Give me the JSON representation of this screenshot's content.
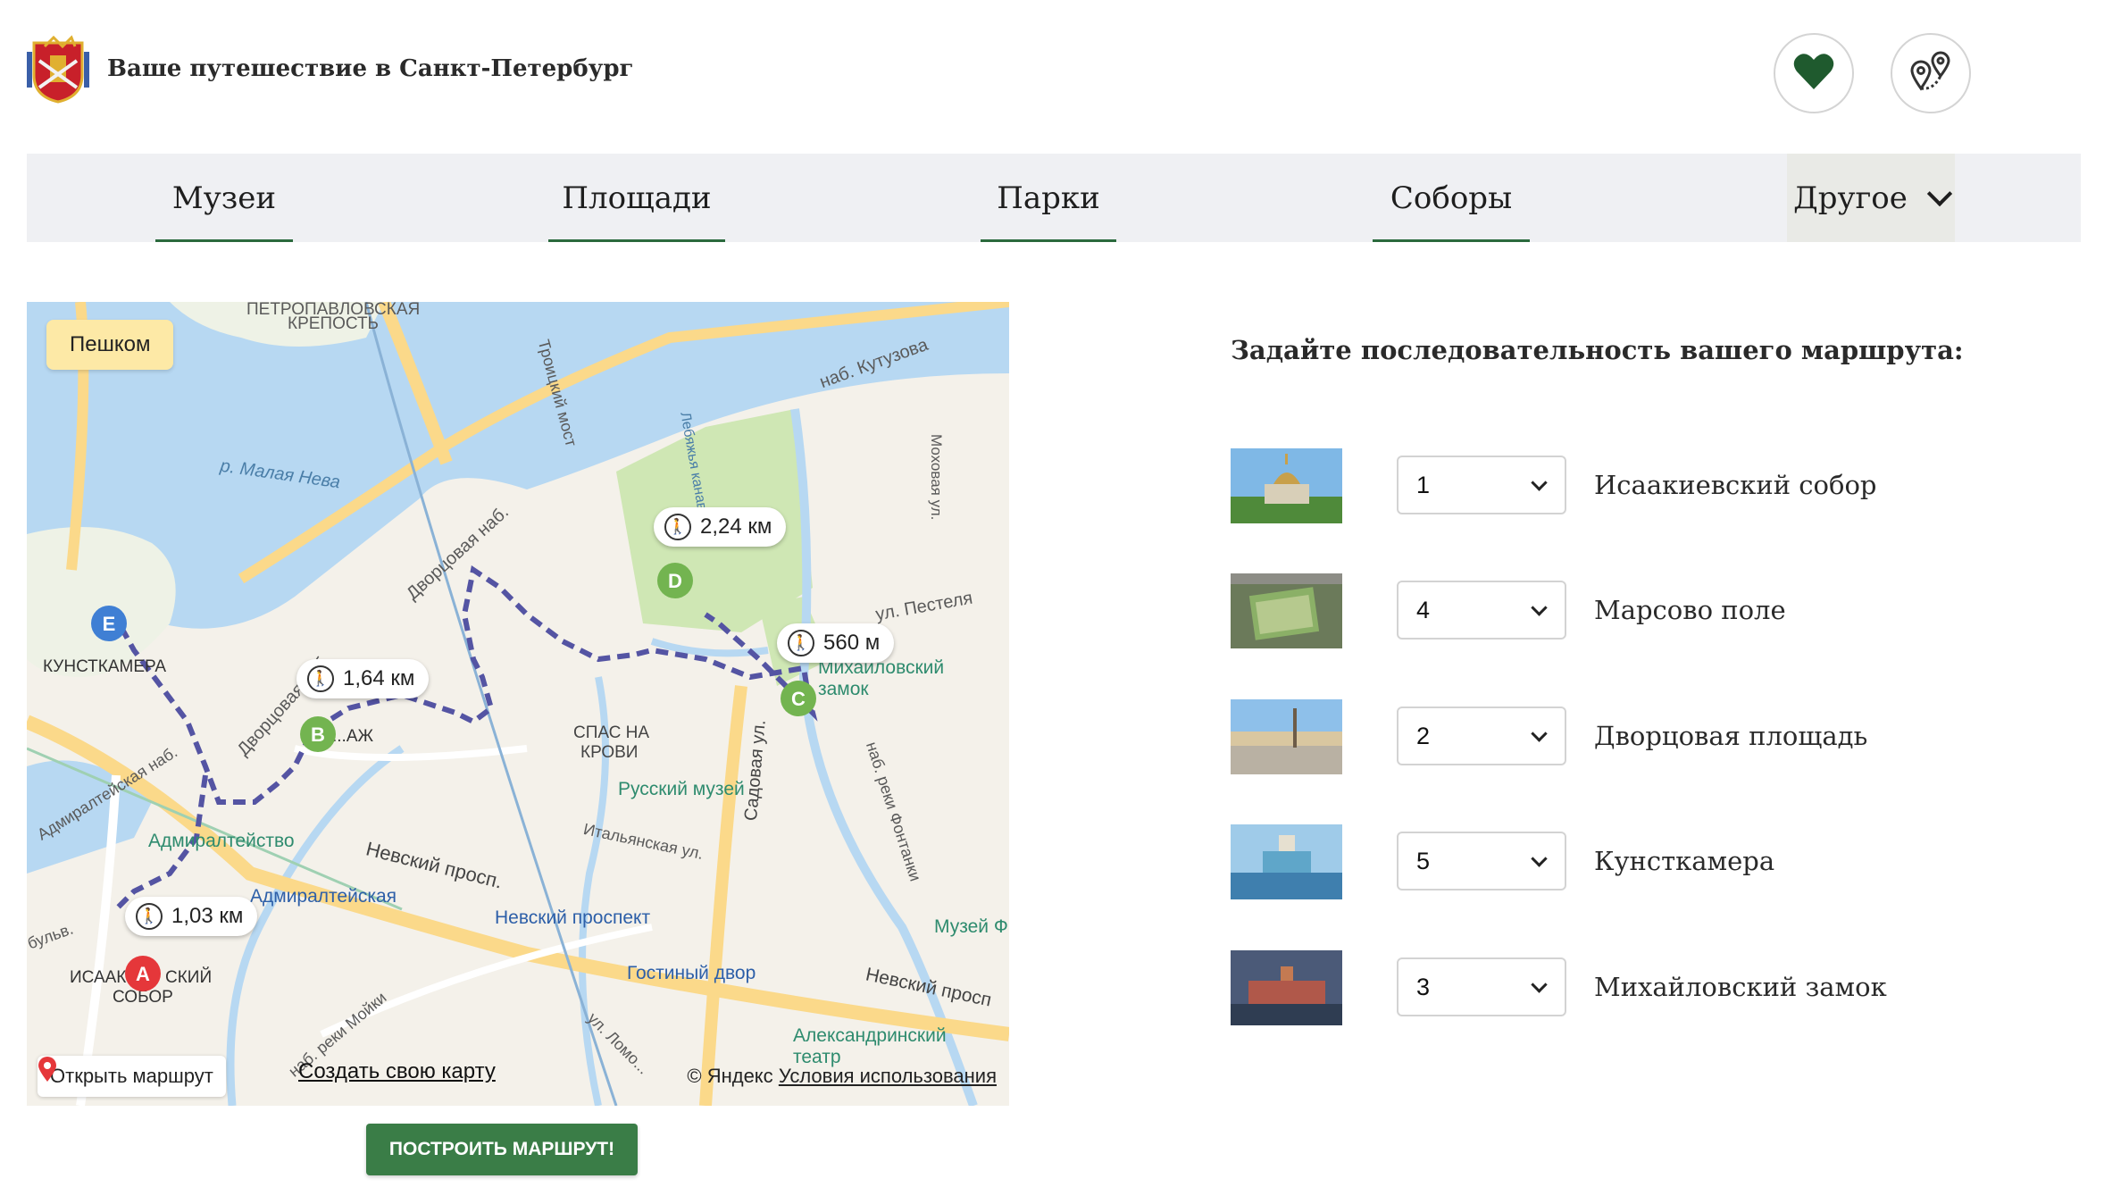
{
  "header": {
    "title": "Ваше путешествие в Санкт-Петербург",
    "logo_icon": "coat-of-arms-icon",
    "favorites_icon": "heart-icon",
    "route_icon": "route-pins-icon",
    "accent_color": "#2b6a3d"
  },
  "nav": {
    "items": [
      {
        "label": "Музеи"
      },
      {
        "label": "Площади"
      },
      {
        "label": "Парки"
      },
      {
        "label": "Соборы"
      }
    ],
    "more_label": "Другое"
  },
  "map": {
    "mode_label": "Пешком",
    "distances": [
      "2,24 км",
      "1,64 км",
      "560 м",
      "1,03 км"
    ],
    "markers": [
      "A",
      "B",
      "C",
      "D",
      "E"
    ],
    "labels": {
      "fortress_1": "ПЕТРОПАВЛОВСКАЯ",
      "fortress_2": "КРЕПОСТЬ",
      "bridge": "Троицкий мост",
      "kutuzova": "наб. Кутузова",
      "malaya_neva": "р. Малая Нева",
      "lebyazhya": "Лебяжья канавка",
      "mokhovaya": "Моховая ул.",
      "dvortsovaya": "Дворцовая наб.",
      "pestelya": "ул. Пестеля",
      "kunstkamera": "КУНСТКАМЕРА",
      "mikhailovsky_1": "Михайловский",
      "mikhailovsky_2": "замок",
      "savior_1": "СПАС НА",
      "savior_2": "КРОВИ",
      "russian_museum": "Русский музей",
      "hermitage": "...АЖ",
      "admiralteysky": "Адмиралтейство",
      "admiralteyskaya_nab": "Адмиралтейская наб.",
      "italyanskaya": "Итальянская ул.",
      "sadovaya": "Садовая ул.",
      "fontanka": "наб. реки Фонтанки",
      "nevsky": "Невский просп.",
      "admiralteyskaya_metro": "Адмиралтейская",
      "nevsky_metro": "Невский проспект",
      "gostiny": "Гостиный двор",
      "museum_right": "Музей Ф",
      "nevsky_right": "Невский просп",
      "alexandrinsky_1": "Александринский",
      "alexandrinsky_2": "театр",
      "moika": "наб. реки Мойки",
      "isaac_1": "ИСААК",
      "isaac_2": "СКИЙ",
      "isaac_3": "СОБОР",
      "bulv": "бульв.",
      "lomo": "ул. Ломо..."
    },
    "open_route": "Открыть маршрут",
    "create_map": "Создать свою карту",
    "copyright": "© Яндекс",
    "terms": "Условия использования",
    "route_color": "#5a5aa8"
  },
  "build_button": "ПОСТРОИТЬ МАРШРУТ!",
  "route": {
    "heading": "Задайте последовательность вашего маршрута:",
    "stops": [
      {
        "order": "1",
        "name": "Исаакиевский собор",
        "thumb_icon": "isaac-cathedral-photo"
      },
      {
        "order": "4",
        "name": "Марсово поле",
        "thumb_icon": "field-of-mars-photo"
      },
      {
        "order": "2",
        "name": "Дворцовая площадь",
        "thumb_icon": "palace-square-photo"
      },
      {
        "order": "5",
        "name": "Кунсткамера",
        "thumb_icon": "kunstkamera-photo"
      },
      {
        "order": "3",
        "name": "Михайловский замок",
        "thumb_icon": "mikhailovsky-castle-photo"
      }
    ]
  }
}
